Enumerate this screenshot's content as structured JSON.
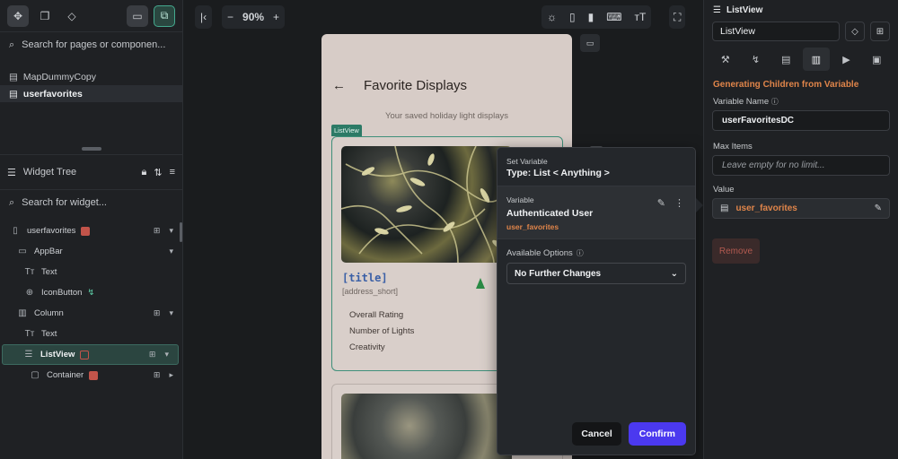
{
  "left_panel": {
    "search_pages_placeholder": "Search for pages or componen...",
    "pages": [
      {
        "label": "MapDummyCopy",
        "active": false
      },
      {
        "label": "userfavorites",
        "active": true
      }
    ],
    "widget_tree_title": "Widget Tree",
    "search_widget_placeholder": "Search for widget...",
    "tree": [
      {
        "label": "userfavorites",
        "icon": "phone-icon"
      },
      {
        "label": "AppBar",
        "icon": "appbar-icon"
      },
      {
        "label": "Text",
        "icon": "text-icon"
      },
      {
        "label": "IconButton",
        "icon": "icon-button-icon"
      },
      {
        "label": "Column",
        "icon": "column-icon"
      },
      {
        "label": "Text",
        "icon": "text-icon"
      },
      {
        "label": "ListView",
        "icon": "listview-icon"
      },
      {
        "label": "Container",
        "icon": "container-icon"
      }
    ]
  },
  "toolbar": {
    "zoom": "90%",
    "zoom_out": "−",
    "zoom_in": "+"
  },
  "phone": {
    "title": "Favorite Displays",
    "subtitle": "Your saved holiday light displays",
    "listview_label": "ListView",
    "card": {
      "title": "[title]",
      "address": "[address_short]",
      "items": [
        "Overall Rating",
        "Number of Lights",
        "Creativity"
      ]
    }
  },
  "popup": {
    "set_variable_label": "Set Variable",
    "type_label": "Type: List < Anything >",
    "variable_label": "Variable",
    "variable_source": "Authenticated User",
    "variable_field": "user_favorites",
    "available_options_label": "Available Options",
    "selected_option": "No Further Changes",
    "cancel": "Cancel",
    "confirm": "Confirm"
  },
  "right_panel": {
    "header": "ListView",
    "name_value": "ListView",
    "generating_title": "Generating Children from Variable",
    "variable_name_label": "Variable Name",
    "variable_name_value": "userFavoritesDC",
    "max_items_label": "Max Items",
    "max_items_placeholder": "Leave empty for no limit...",
    "value_label": "Value",
    "value_value": "user_favorites",
    "remove_button": "Remove"
  },
  "colors": {
    "accent_teal": "#3f8f7a",
    "accent_orange": "#e0854a",
    "confirm_blue": "#4b39ef",
    "card_title_blue": "#3a5fa6"
  }
}
